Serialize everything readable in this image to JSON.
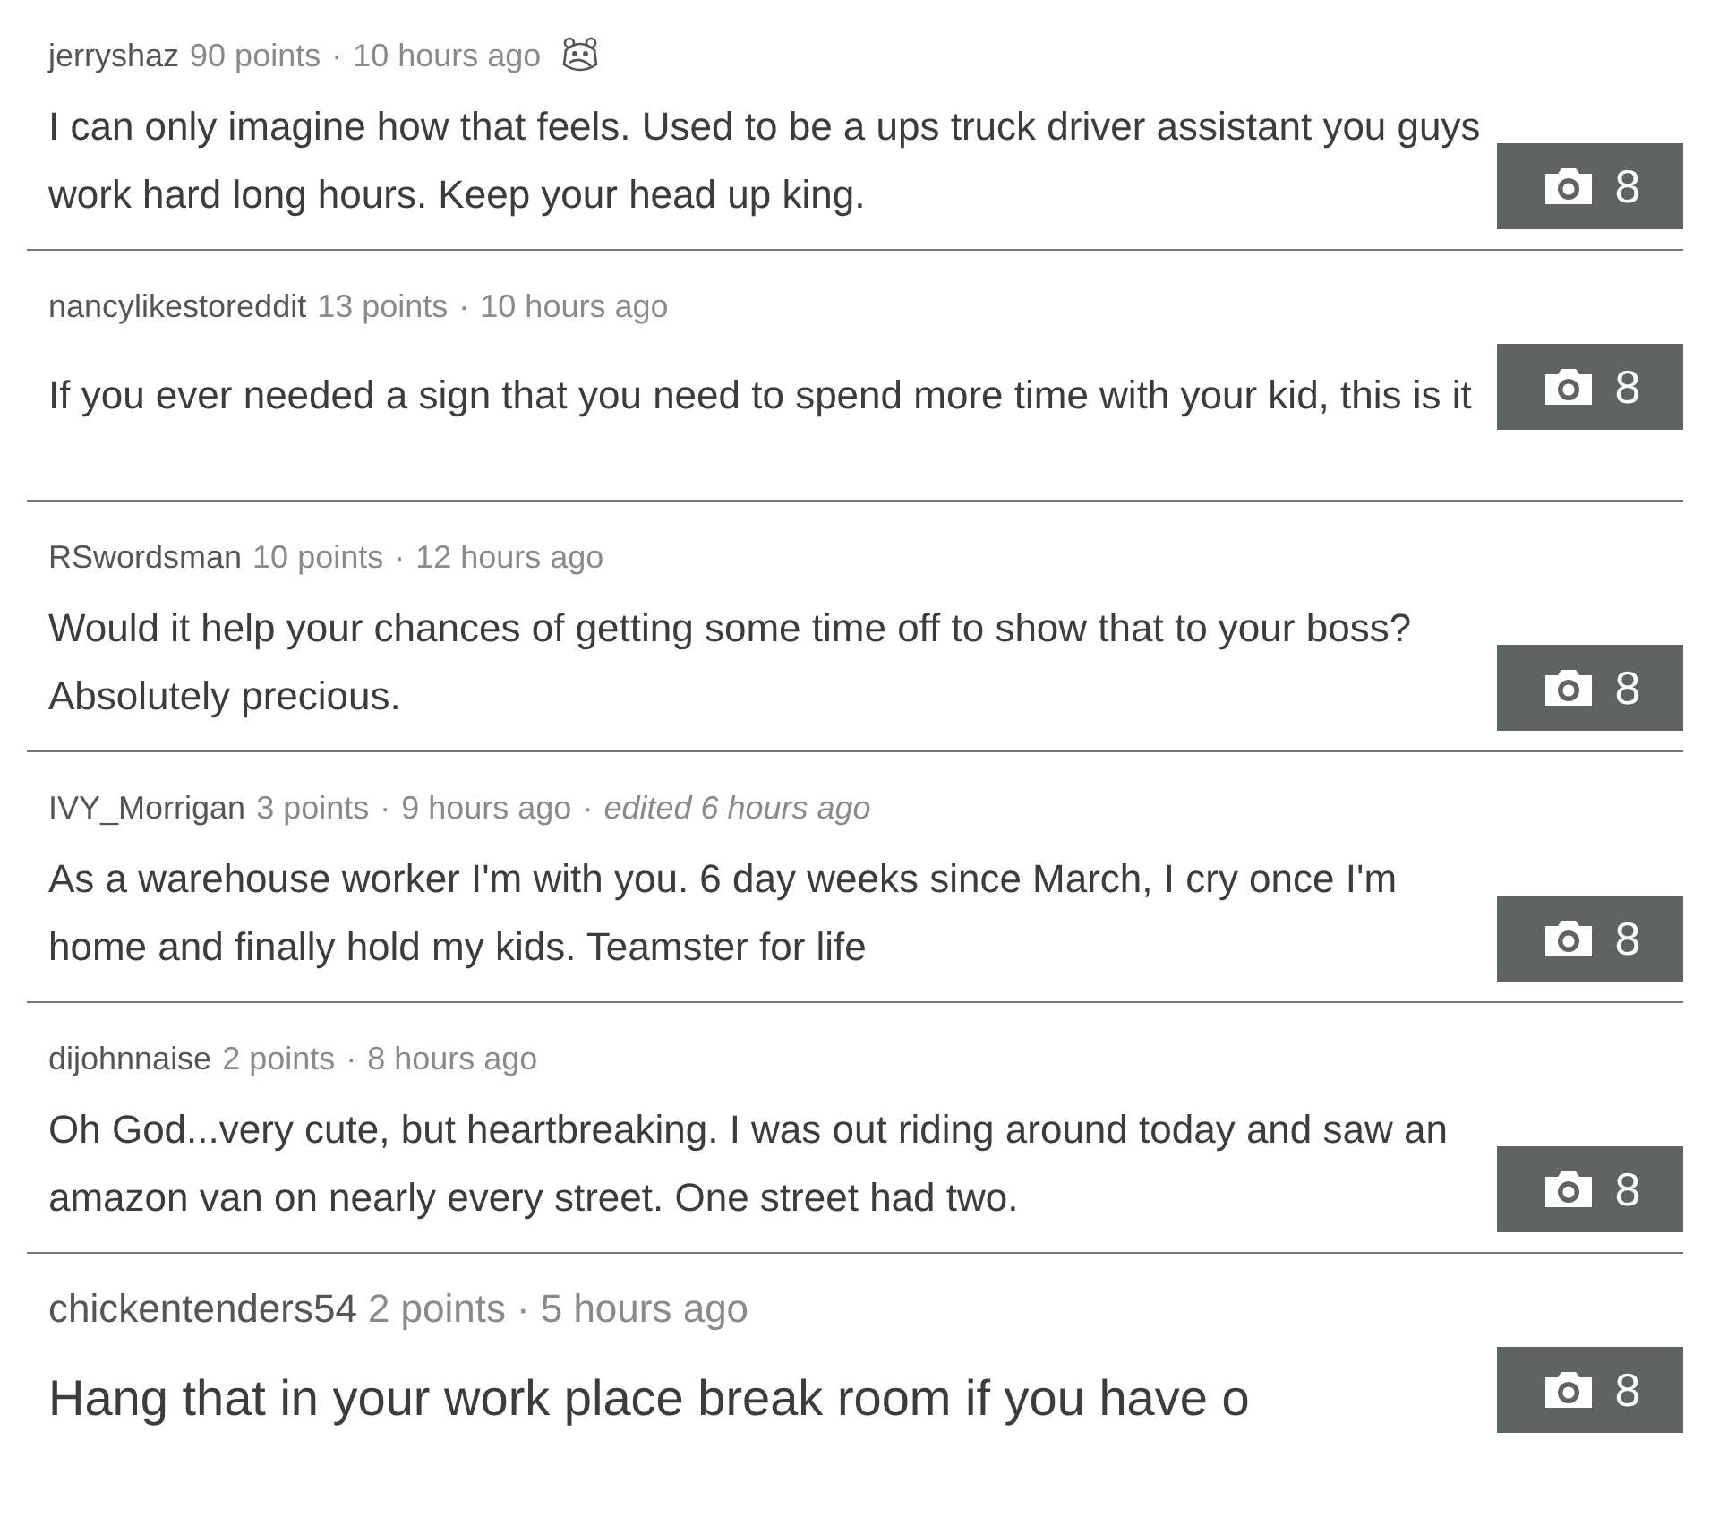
{
  "comments": [
    {
      "author": "jerryshaz",
      "points": "90 points",
      "separator": "·",
      "time": "10 hours ago",
      "award": true,
      "text": "I can only imagine how that feels. Used to be a ups truck driver assistant you guys work hard long hours. Keep your head up king.",
      "photo_count": "8"
    },
    {
      "author": "nancylikestoreddit",
      "points": "13 points",
      "separator": "·",
      "time": "10 hours ago",
      "award": false,
      "text": "If you ever needed a sign that you need to spend more time with your kid, this is it",
      "photo_count": "8"
    },
    {
      "author": "RSwordsman",
      "points": "10 points",
      "separator": "·",
      "time": "12 hours ago",
      "award": false,
      "text": "Would it help your chances of getting some time off to show that to your boss? Absolutely precious.",
      "photo_count": "8"
    },
    {
      "author": "IVY_Morrigan",
      "points": "3 points",
      "separator": "·",
      "time": "9 hours ago",
      "edited_separator": "·",
      "edited": "edited 6 hours ago",
      "award": false,
      "text": "As a warehouse worker I'm with you. 6 day weeks since March, I cry once I'm home and finally hold my kids. Teamster for life",
      "photo_count": "8"
    },
    {
      "author": "dijohnnaise",
      "points": "2 points",
      "separator": "·",
      "time": "8 hours ago",
      "award": false,
      "text": "Oh God...very cute, but heartbreaking. I was out riding around today and saw an amazon van on nearly every street. One street had two.",
      "photo_count": "8"
    },
    {
      "author": "chickentenders54",
      "points": "2 points",
      "separator": "·",
      "time": "5 hours ago",
      "award": false,
      "text": "Hang that in your work place break room if you have o",
      "photo_count": "8"
    }
  ]
}
